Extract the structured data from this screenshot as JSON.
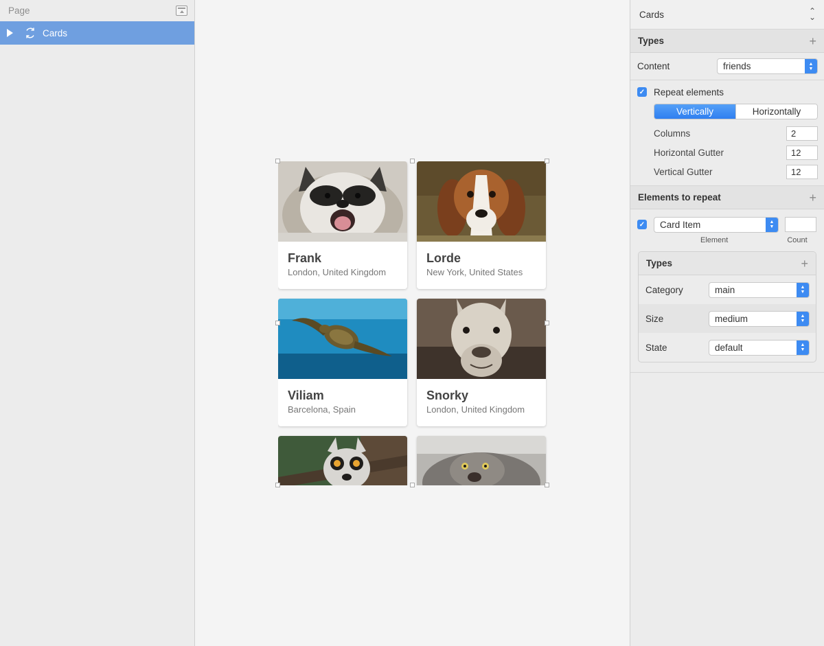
{
  "left_panel": {
    "header": "Page",
    "layers": [
      {
        "label": "Cards"
      }
    ]
  },
  "canvas": {
    "cards": [
      {
        "name": "Frank",
        "location": "London, United Kingdom",
        "photo": "raccoon-photo"
      },
      {
        "name": "Lorde",
        "location": "New York, United States",
        "photo": "beagle-photo"
      },
      {
        "name": "Viliam",
        "location": "Barcelona, Spain",
        "photo": "sea-turtle-photo"
      },
      {
        "name": "Snorky",
        "location": "London, United Kingdom",
        "photo": "llama-photo"
      },
      {
        "name": "",
        "location": "",
        "photo": "lemur-photo"
      },
      {
        "name": "",
        "location": "",
        "photo": "manul-cat-photo"
      }
    ]
  },
  "inspector": {
    "title": "Cards",
    "types_label": "Types",
    "content_label": "Content",
    "content_value": "friends",
    "repeat_label": "Repeat elements",
    "repeat_checked": true,
    "vertically_label": "Vertically",
    "horizontally_label": "Horizontally",
    "active_direction": "Vertically",
    "columns_label": "Columns",
    "columns_value": "2",
    "h_gutter_label": "Horizontal Gutter",
    "h_gutter_value": "12",
    "v_gutter_label": "Vertical Gutter",
    "v_gutter_value": "12",
    "elements_label": "Elements to repeat",
    "element_value": "Card Item",
    "element_checked": true,
    "count_value": "",
    "element_caption": "Element",
    "count_caption": "Count",
    "sub_types_label": "Types",
    "category_label": "Category",
    "category_value": "main",
    "size_label": "Size",
    "size_value": "medium",
    "state_label": "State",
    "state_value": "default"
  },
  "colors": {
    "accent": "#3d8bf2",
    "selection": "#6f9fe0"
  }
}
